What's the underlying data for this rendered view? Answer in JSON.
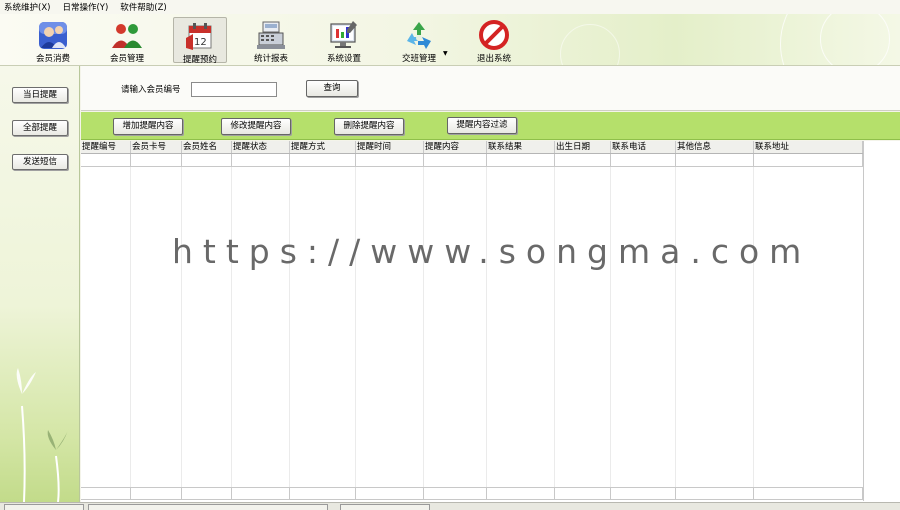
{
  "menu": [
    "系统维护(X)",
    "日常操作(Y)",
    "软件帮助(Z)"
  ],
  "toolbar": [
    {
      "label": "会员消费",
      "icon": "members-blue-icon"
    },
    {
      "label": "会员管理",
      "icon": "members-group-icon"
    },
    {
      "label": "提醒预约",
      "icon": "calendar-reminder-icon",
      "active": true
    },
    {
      "label": "统计报表",
      "icon": "cash-register-icon"
    },
    {
      "label": "系统设置",
      "icon": "settings-screen-icon"
    },
    {
      "label": "交班管理",
      "icon": "recycle-icon"
    },
    {
      "label": "退出系统",
      "icon": "exit-forbidden-icon"
    }
  ],
  "left_buttons": [
    "当日提醒",
    "全部提醒",
    "发送短信"
  ],
  "search": {
    "label": "请输入会员编号",
    "value": "",
    "button": "查询"
  },
  "actions": [
    "增加提醒内容",
    "修改提醒内容",
    "删除提醒内容",
    "提醒内容过滤"
  ],
  "table": {
    "columns": [
      "提醒编号",
      "会员卡号",
      "会员姓名",
      "提醒状态",
      "提醒方式",
      "提醒时间",
      "提醒内容",
      "联系结果",
      "出生日期",
      "联系电话",
      "其他信息",
      "联系地址"
    ],
    "rows": []
  },
  "watermark": "https://www.songma.com",
  "colors": {
    "action_bar": "#b5e06b",
    "accent_green": "#c2db8a"
  }
}
